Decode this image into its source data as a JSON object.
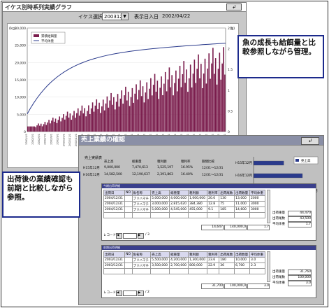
{
  "window1": {
    "title": "イケス別時系列実績グラフ",
    "cage_label": "イケス選択",
    "cage_value": "2003120",
    "date_label": "表示日入日",
    "date_value": "2002/04/22",
    "left_axis_label": "(kg)",
    "right_axis_label": "(g)",
    "left_ticks": [
      "30,000",
      "25,000",
      "20,000",
      "15,000",
      "10,000",
      "5,000",
      "0"
    ],
    "right_ticks": [
      "2.5",
      "2",
      "1.5",
      "1",
      "0.5",
      "0"
    ],
    "legend": [
      "累積給餌量",
      "平均体重"
    ]
  },
  "window2": {
    "title": "売上業績の確認",
    "summary_section": "売上実績表",
    "summary_headers": [
      "",
      "売上高",
      "総重量",
      "粗利額",
      "粗利率",
      "期間比較"
    ],
    "summary_rows": [
      [
        "H15年12月",
        "9,000,000",
        "7,470,613",
        "1,525,197",
        "16.95%",
        "12/31～12/31"
      ],
      [
        "H16年12月",
        "14,582,500",
        "12,190,637",
        "2,391,863",
        "16.40%",
        "12/31～12/31"
      ]
    ],
    "bar_labels": [
      "H15年12月",
      "H16年12月"
    ],
    "bar_legend": "売上高",
    "bar_axis": [
      "0",
      "5",
      "10",
      "15"
    ],
    "bar_unit": "百万円",
    "table1_title": "今期出荷明細",
    "table1_headers": [
      "出荷日",
      "NO",
      "魚名称",
      "売上高",
      "総重量",
      "粗利額",
      "粗利率",
      "出荷尾数",
      "出荷数量",
      "平均体重"
    ],
    "table1_rows": [
      [
        "2004/12/31",
        "",
        "ブリハマチ",
        "5,000,000",
        "4,000,000",
        "1,000,000",
        "20.0",
        "130",
        "13,000",
        "2000"
      ],
      [
        "2004/12/31",
        "",
        "ブリハマチ",
        "3,000,000",
        "2,815,620",
        "384,380",
        "12.8",
        "75",
        "11,000",
        "3000"
      ],
      [
        "2004/12/31",
        "",
        "ブリハマチ",
        "5,000,000",
        "4,545,000",
        "455,000",
        "9.1",
        "185",
        "14,600",
        "3000"
      ]
    ],
    "table1_total": [
      "14,647",
      "140,000,0",
      "1.7"
    ],
    "table1_side": [
      [
        "出荷重量",
        "44,470"
      ],
      [
        "出荷尾数",
        "43,500"
      ],
      [
        "平均体重",
        "1.7"
      ]
    ],
    "table2_title": "前期出荷明細",
    "table2_headers": [
      "出荷日",
      "NO",
      "魚名称",
      "売上高",
      "総重量",
      "粗利額",
      "粗利率",
      "出荷尾数",
      "出荷数量",
      "平均体重"
    ],
    "table2_rows": [
      [
        "2003/12/31",
        "",
        "ブリハマチ",
        "5,500,000",
        "4,200,000",
        "1,300,000",
        "23.6",
        "180",
        "10,000",
        "3.0"
      ],
      [
        "2003/12/31",
        "",
        "ブリハマチ",
        "3,500,000",
        "2,700,000",
        "800,000",
        "22.9",
        "36",
        "6,700",
        "2.3"
      ]
    ],
    "table2_total": [
      "31,700",
      "100,000,0",
      "3.0"
    ],
    "table2_side": [
      [
        "出荷重量",
        "31,760"
      ],
      [
        "出荷尾数",
        "100,000"
      ],
      [
        "平均体重",
        "3.0"
      ]
    ],
    "record_label": "レコード",
    "record_count": "/ 3",
    "record_count2": "/ 2"
  },
  "callouts": {
    "top": "魚の成長も給餌量と比較参照しながら管理。",
    "bottom": "出荷後の業績確認も前期と比較しながら参照。"
  },
  "colors": {
    "bar": "#7a1c4c",
    "curve": "#2a3a8c",
    "titlebar2": "#8a8fa6",
    "callout_border": "#1c2a8c"
  }
}
